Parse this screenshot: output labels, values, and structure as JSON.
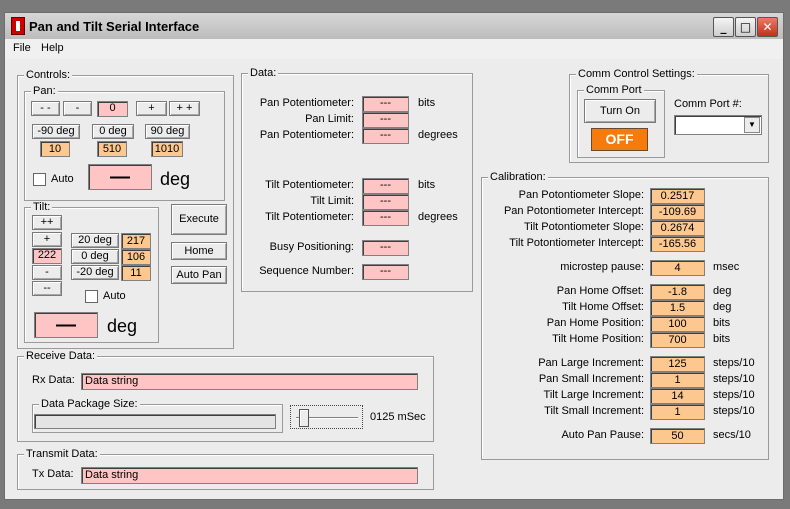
{
  "window": {
    "title": "Pan and Tilt Serial Interface",
    "minimize": "_",
    "maximize": "□",
    "close": "✕"
  },
  "menu": {
    "file": "File",
    "help": "Help"
  },
  "controls": {
    "legend": "Controls:",
    "pan": {
      "legend": "Pan:",
      "btn_fast_left": "- -",
      "btn_left": "-",
      "value": "0",
      "btn_right": "+",
      "btn_fast_right": "+ +",
      "preset_m90": "-90 deg",
      "preset_0": "0 deg",
      "preset_90": "90 deg",
      "val_m90": "10",
      "val_0": "510",
      "val_90": "1010",
      "auto": "Auto",
      "display": "—",
      "unit": "deg"
    },
    "tilt": {
      "legend": "Tilt:",
      "btn_fast_up": "++",
      "btn_up": "+",
      "value": "222",
      "btn_down": "-",
      "btn_fast_down": "--",
      "preset_20": "20 deg",
      "preset_0": "0 deg",
      "preset_m20": "-20 deg",
      "val_20": "217",
      "val_0": "106",
      "val_m20": "11",
      "auto": "Auto",
      "display": "—",
      "unit": "deg"
    },
    "execute": "Execute",
    "home": "Home",
    "auto_pan": "Auto Pan"
  },
  "data": {
    "legend": "Data:",
    "rows": [
      {
        "label": "Pan Potentiometer:",
        "value": "---",
        "unit": "bits"
      },
      {
        "label": "Pan Limit:",
        "value": "---",
        "unit": ""
      },
      {
        "label": "Pan Potentiometer:",
        "value": "---",
        "unit": "degrees"
      },
      {
        "label": "Tilt Potentiometer:",
        "value": "---",
        "unit": "bits"
      },
      {
        "label": "Tilt Limit:",
        "value": "---",
        "unit": ""
      },
      {
        "label": "Tilt Potentiometer:",
        "value": "---",
        "unit": "degrees"
      },
      {
        "label": "Busy Positioning:",
        "value": "---",
        "unit": ""
      },
      {
        "label": "Sequence Number:",
        "value": "---",
        "unit": ""
      }
    ]
  },
  "comm": {
    "legend": "Comm Control Settings:",
    "port_legend": "Comm Port",
    "turn_on": "Turn On",
    "status": "OFF",
    "status_color": "#f57c0c",
    "port_label": "Comm Port #:",
    "port_value": ""
  },
  "calibration": {
    "legend": "Calibration:",
    "rows": [
      {
        "label": "Pan Potontiometer Slope:",
        "value": "0.2517",
        "unit": ""
      },
      {
        "label": "Pan Potontiometer Intercept:",
        "value": "-109.69",
        "unit": ""
      },
      {
        "label": "Tilt Potontiometer Slope:",
        "value": "0.2674",
        "unit": ""
      },
      {
        "label": "Tilt Potontiometer Intercept:",
        "value": "-165.56",
        "unit": ""
      },
      {
        "label": "microstep pause:",
        "value": "4",
        "unit": "msec"
      },
      {
        "label": "Pan Home Offset:",
        "value": "-1.8",
        "unit": "deg"
      },
      {
        "label": "Tilt Home Offset:",
        "value": "1.5",
        "unit": "deg"
      },
      {
        "label": "Pan Home Position:",
        "value": "100",
        "unit": "bits"
      },
      {
        "label": "Tilt Home Position:",
        "value": "700",
        "unit": "bits"
      },
      {
        "label": "Pan Large Increment:",
        "value": "125",
        "unit": "steps/10"
      },
      {
        "label": "Pan Small Increment:",
        "value": "1",
        "unit": "steps/10"
      },
      {
        "label": "Tilt Large Increment:",
        "value": "14",
        "unit": "steps/10"
      },
      {
        "label": "Tilt Small Increment:",
        "value": "1",
        "unit": "steps/10"
      },
      {
        "label": "Auto Pan Pause:",
        "value": "50",
        "unit": "secs/10"
      }
    ]
  },
  "receive": {
    "legend": "Receive Data:",
    "rx_label": "Rx Data:",
    "rx_value": "Data string",
    "pkg_legend": "Data Package Size:",
    "pkg_progress": 0,
    "slider_value": "0125 mSec"
  },
  "transmit": {
    "legend": "Transmit Data:",
    "tx_label": "Tx Data:",
    "tx_value": "Data string"
  }
}
